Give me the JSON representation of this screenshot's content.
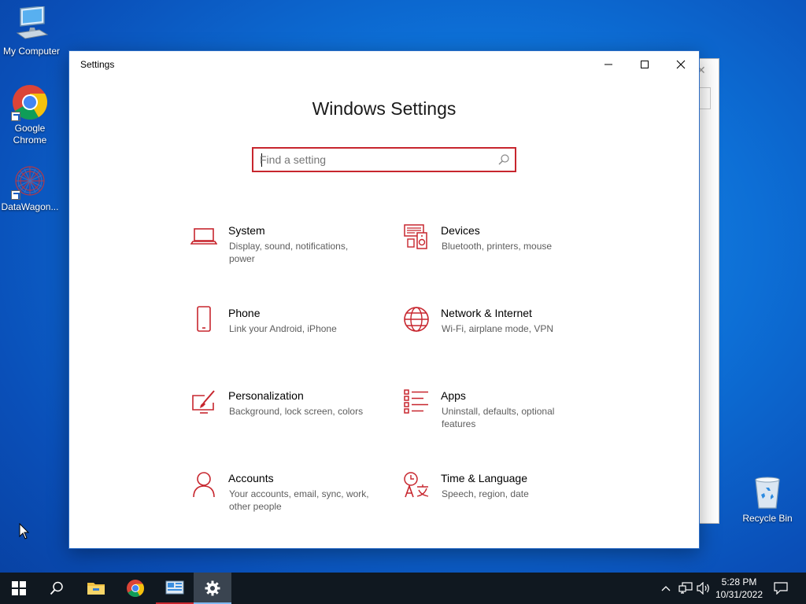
{
  "desktop": {
    "icons": [
      {
        "label": "My Computer"
      },
      {
        "label": "Google Chrome"
      },
      {
        "label": "DataWagon..."
      },
      {
        "label": "Recycle Bin"
      }
    ]
  },
  "window": {
    "title": "Settings",
    "heading": "Windows Settings",
    "search_placeholder": "Find a setting",
    "accent_color": "#c7262e",
    "categories": [
      {
        "name": "System",
        "description": "Display, sound, notifications, power",
        "icon": "laptop-icon"
      },
      {
        "name": "Devices",
        "description": "Bluetooth, printers, mouse",
        "icon": "devices-icon"
      },
      {
        "name": "Phone",
        "description": "Link your Android, iPhone",
        "icon": "phone-icon"
      },
      {
        "name": "Network & Internet",
        "description": "Wi-Fi, airplane mode, VPN",
        "icon": "globe-icon"
      },
      {
        "name": "Personalization",
        "description": "Background, lock screen, colors",
        "icon": "paint-brush-icon"
      },
      {
        "name": "Apps",
        "description": "Uninstall, defaults, optional features",
        "icon": "apps-list-icon"
      },
      {
        "name": "Accounts",
        "description": "Your accounts, email, sync, work, other people",
        "icon": "person-icon"
      },
      {
        "name": "Time & Language",
        "description": "Speech, region, date",
        "icon": "time-language-icon"
      }
    ]
  },
  "taskbar": {
    "time": "5:28 PM",
    "date": "10/31/2022"
  }
}
